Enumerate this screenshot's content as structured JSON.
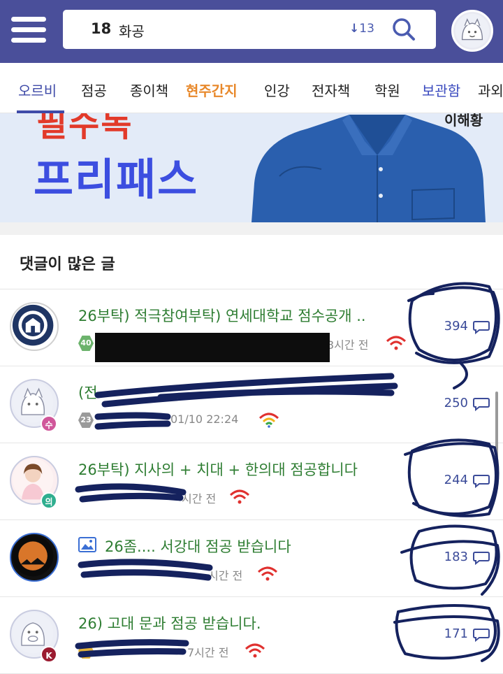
{
  "header": {
    "search_rank": "18",
    "search_term": "화공",
    "rank_change": "13",
    "rank_change_arrow": "↓"
  },
  "nav": {
    "tabs": [
      {
        "label": "오르비"
      },
      {
        "label": "점공"
      },
      {
        "label": "종이책"
      },
      {
        "label": "현주간지"
      },
      {
        "label": "인강"
      },
      {
        "label": "전자책"
      },
      {
        "label": "학원"
      },
      {
        "label": "보관함"
      },
      {
        "label": "과외"
      }
    ]
  },
  "banner": {
    "top_text": "필수독",
    "main_text": "프리패스",
    "name_text": "이해황"
  },
  "section": {
    "title": "댓글이 많은 글"
  },
  "posts": [
    {
      "title": "26부탁) 적극참여부탁) 연세대학교 점수공개 ..",
      "level": "40",
      "time": "3시간 전",
      "comments": "394",
      "badge": ""
    },
    {
      "title": "(전",
      "level": "23",
      "time": "01/10 22:24",
      "comments": "250",
      "badge": "수"
    },
    {
      "title": "26부탁) 지사의 + 치대 + 한의대 점공합니다",
      "level": "",
      "time": "시간 전",
      "comments": "244",
      "badge": "의"
    },
    {
      "title": "26좀.... 서강대 점공 받습니다",
      "level": "",
      "time": "시간 전",
      "comments": "183",
      "badge": ""
    },
    {
      "title": "26) 고대 문과 점공 받습니다.",
      "level": "",
      "time": "7시간 전",
      "comments": "171",
      "badge": "K"
    }
  ],
  "colors": {
    "header_bg": "#4a4f9a",
    "title_green": "#2e7d32",
    "count_blue": "#3b4b99",
    "tab_orange": "#e8882a",
    "tab_blue": "#3b4bbf",
    "ink_marks": "#15225e"
  }
}
